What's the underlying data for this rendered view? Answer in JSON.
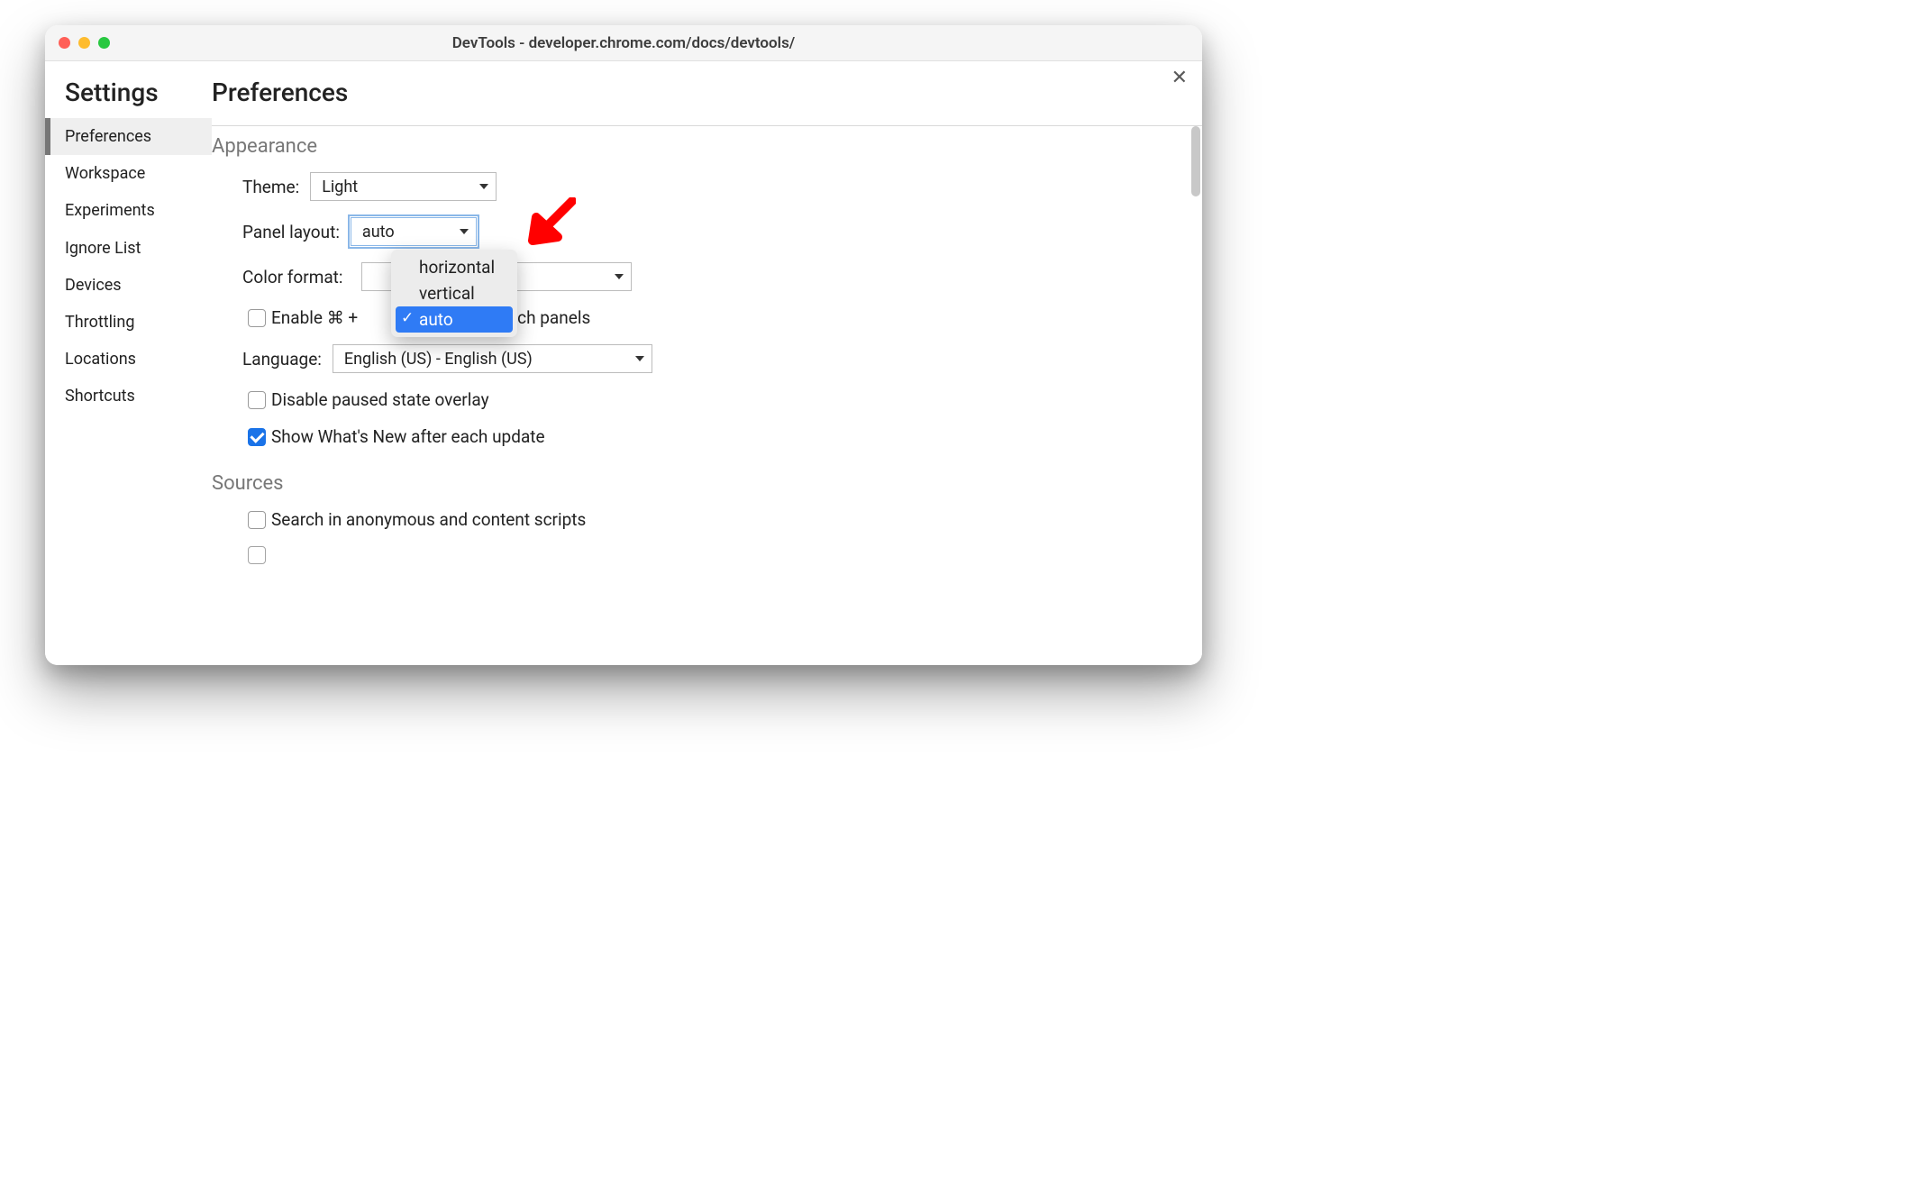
{
  "window": {
    "title": "DevTools - developer.chrome.com/docs/devtools/"
  },
  "settings": {
    "title": "Settings"
  },
  "sidebar": {
    "items": [
      {
        "label": "Preferences"
      },
      {
        "label": "Workspace"
      },
      {
        "label": "Experiments"
      },
      {
        "label": "Ignore List"
      },
      {
        "label": "Devices"
      },
      {
        "label": "Throttling"
      },
      {
        "label": "Locations"
      },
      {
        "label": "Shortcuts"
      }
    ],
    "selected_index": 0
  },
  "page": {
    "title": "Preferences"
  },
  "appearance": {
    "section_title": "Appearance",
    "theme_label": "Theme:",
    "theme_value": "Light",
    "panel_layout_label": "Panel layout:",
    "panel_layout_value": "auto",
    "panel_layout_options": [
      "horizontal",
      "vertical",
      "auto"
    ],
    "panel_layout_selected": "auto",
    "color_format_label": "Color format:",
    "color_format_value": "",
    "enable_cmd_label_prefix": "Enable ⌘ + ",
    "enable_cmd_label_suffix": " switch panels",
    "enable_cmd_checked": false,
    "language_label": "Language:",
    "language_value": "English (US) - English (US)",
    "disable_paused_label": "Disable paused state overlay",
    "disable_paused_checked": false,
    "show_whats_new_label": "Show What's New after each update",
    "show_whats_new_checked": true
  },
  "sources": {
    "section_title": "Sources",
    "search_anon_label": "Search in anonymous and content scripts",
    "search_anon_checked": false
  }
}
